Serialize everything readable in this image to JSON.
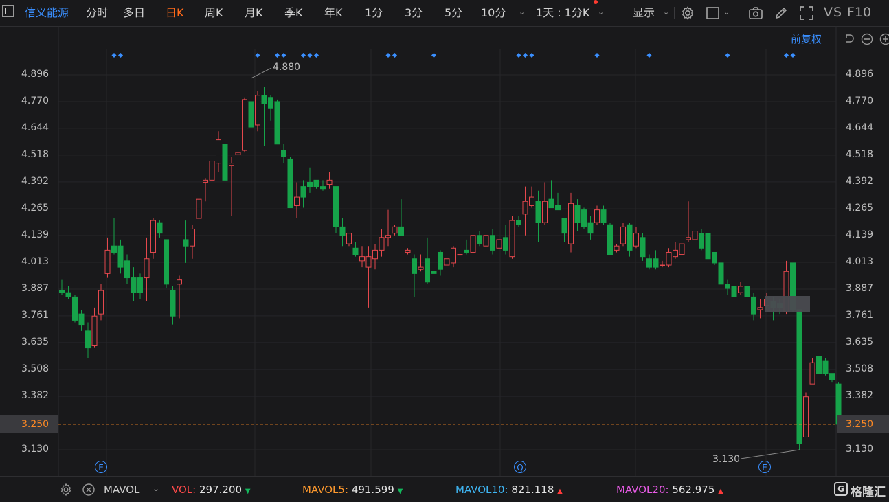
{
  "toolbar": {
    "stock_name": "信义能源",
    "periods": [
      "分时",
      "多日",
      "日K",
      "周K",
      "月K",
      "季K",
      "年K",
      "1分",
      "3分",
      "5分",
      "10分"
    ],
    "active_period": "日K",
    "range_selector": "1天 : 1分K",
    "display_menu": "显示",
    "vs": "VS",
    "f10": "F10"
  },
  "chart_controls": {
    "adjust_mode": "前复权"
  },
  "price_axis": {
    "ticks": [
      "4.896",
      "4.770",
      "4.644",
      "4.518",
      "4.392",
      "4.265",
      "4.139",
      "4.013",
      "3.887",
      "3.761",
      "3.635",
      "3.508",
      "3.382",
      "3.250",
      "3.130"
    ],
    "current_price": "3.250"
  },
  "annotations": {
    "high_label": "4.880",
    "low_label": "3.130",
    "events": [
      "E",
      "Q",
      "E"
    ]
  },
  "indicator_bar": {
    "indicator_name": "MAVOL",
    "vol_label": "VOL:",
    "vol_value": "297.200",
    "ma5_label": "MAVOL5:",
    "ma5_value": "491.599",
    "ma10_label": "MAVOL10:",
    "ma10_value": "821.118",
    "ma20_label": "MAVOL20:",
    "ma20_value": "562.975",
    "brand": "格隆汇"
  },
  "colors": {
    "up": "#e5484d",
    "down": "#16a34a",
    "accent": "#3a8fff",
    "active_tab": "#ff6a1a",
    "current_price_line": "#ff8a24"
  },
  "chart_data": {
    "type": "candlestick",
    "ylim": [
      3.1,
      4.95
    ],
    "candles": [
      {
        "o": 3.88,
        "h": 3.93,
        "l": 3.86,
        "c": 3.87
      },
      {
        "o": 3.87,
        "h": 3.9,
        "l": 3.84,
        "c": 3.85
      },
      {
        "o": 3.85,
        "h": 3.86,
        "l": 3.73,
        "c": 3.74
      },
      {
        "o": 3.77,
        "h": 3.79,
        "l": 3.69,
        "c": 3.72
      },
      {
        "o": 3.69,
        "h": 3.73,
        "l": 3.56,
        "c": 3.61
      },
      {
        "o": 3.62,
        "h": 3.8,
        "l": 3.61,
        "c": 3.76
      },
      {
        "o": 3.77,
        "h": 3.91,
        "l": 3.74,
        "c": 3.88
      },
      {
        "o": 3.96,
        "h": 4.13,
        "l": 3.94,
        "c": 4.07
      },
      {
        "o": 4.09,
        "h": 4.22,
        "l": 4.05,
        "c": 4.06
      },
      {
        "o": 4.09,
        "h": 4.12,
        "l": 3.96,
        "c": 3.99
      },
      {
        "o": 4.02,
        "h": 4.05,
        "l": 3.91,
        "c": 3.94
      },
      {
        "o": 3.94,
        "h": 3.99,
        "l": 3.83,
        "c": 3.87
      },
      {
        "o": 3.94,
        "h": 3.96,
        "l": 3.84,
        "c": 3.87
      },
      {
        "o": 3.94,
        "h": 4.13,
        "l": 3.83,
        "c": 4.03
      },
      {
        "o": 4.06,
        "h": 4.22,
        "l": 4.03,
        "c": 4.21
      },
      {
        "o": 4.2,
        "h": 4.21,
        "l": 4.13,
        "c": 4.15
      },
      {
        "o": 4.12,
        "h": 4.12,
        "l": 3.89,
        "c": 3.91
      },
      {
        "o": 3.88,
        "h": 3.9,
        "l": 3.72,
        "c": 3.76
      },
      {
        "o": 3.91,
        "h": 3.95,
        "l": 3.75,
        "c": 3.93
      },
      {
        "o": 4.12,
        "h": 4.21,
        "l": 4.01,
        "c": 4.09
      },
      {
        "o": 4.09,
        "h": 4.19,
        "l": 4.03,
        "c": 4.17
      },
      {
        "o": 4.22,
        "h": 4.33,
        "l": 4.18,
        "c": 4.31
      },
      {
        "o": 4.39,
        "h": 4.41,
        "l": 4.3,
        "c": 4.4
      },
      {
        "o": 4.4,
        "h": 4.56,
        "l": 4.32,
        "c": 4.49
      },
      {
        "o": 4.48,
        "h": 4.63,
        "l": 4.44,
        "c": 4.59
      },
      {
        "o": 4.57,
        "h": 4.67,
        "l": 4.39,
        "c": 4.4
      },
      {
        "o": 4.47,
        "h": 4.51,
        "l": 4.23,
        "c": 4.48
      },
      {
        "o": 4.52,
        "h": 4.69,
        "l": 4.4,
        "c": 4.53
      },
      {
        "o": 4.54,
        "h": 4.79,
        "l": 4.53,
        "c": 4.78
      },
      {
        "o": 4.77,
        "h": 4.88,
        "l": 4.62,
        "c": 4.65
      },
      {
        "o": 4.66,
        "h": 4.82,
        "l": 4.63,
        "c": 4.8
      },
      {
        "o": 4.8,
        "h": 4.84,
        "l": 4.56,
        "c": 4.76
      },
      {
        "o": 4.79,
        "h": 4.8,
        "l": 4.68,
        "c": 4.74
      },
      {
        "o": 4.77,
        "h": 4.78,
        "l": 4.57,
        "c": 4.57
      },
      {
        "o": 4.54,
        "h": 4.57,
        "l": 4.48,
        "c": 4.51
      },
      {
        "o": 4.5,
        "h": 4.51,
        "l": 4.27,
        "c": 4.27
      },
      {
        "o": 4.28,
        "h": 4.39,
        "l": 4.22,
        "c": 4.32
      },
      {
        "o": 4.37,
        "h": 4.4,
        "l": 4.27,
        "c": 4.32
      },
      {
        "o": 4.39,
        "h": 4.46,
        "l": 4.34,
        "c": 4.37
      },
      {
        "o": 4.4,
        "h": 4.4,
        "l": 4.36,
        "c": 4.37
      },
      {
        "o": 4.37,
        "h": 4.4,
        "l": 4.35,
        "c": 4.36
      },
      {
        "o": 4.38,
        "h": 4.44,
        "l": 4.36,
        "c": 4.4
      },
      {
        "o": 4.37,
        "h": 4.37,
        "l": 4.15,
        "c": 4.18
      },
      {
        "o": 4.18,
        "h": 4.22,
        "l": 4.09,
        "c": 4.14
      },
      {
        "o": 4.1,
        "h": 4.15,
        "l": 4.09,
        "c": 4.15
      },
      {
        "o": 4.08,
        "h": 4.11,
        "l": 4.04,
        "c": 4.05
      },
      {
        "o": 4.02,
        "h": 4.09,
        "l": 3.99,
        "c": 4.04
      },
      {
        "o": 3.99,
        "h": 4.09,
        "l": 3.8,
        "c": 4.04
      },
      {
        "o": 4.03,
        "h": 4.1,
        "l": 3.98,
        "c": 4.07
      },
      {
        "o": 4.07,
        "h": 4.17,
        "l": 4.04,
        "c": 4.13
      },
      {
        "o": 4.13,
        "h": 4.26,
        "l": 4.09,
        "c": 4.14
      },
      {
        "o": 4.15,
        "h": 4.19,
        "l": 4.14,
        "c": 4.18
      },
      {
        "o": 4.18,
        "h": 4.31,
        "l": 4.15,
        "c": 4.14
      },
      {
        "o": 4.06,
        "h": 4.08,
        "l": 4.05,
        "c": 4.07
      },
      {
        "o": 4.03,
        "h": 4.05,
        "l": 3.85,
        "c": 3.96
      },
      {
        "o": 3.98,
        "h": 4.05,
        "l": 3.97,
        "c": 3.99
      },
      {
        "o": 4.03,
        "h": 4.13,
        "l": 3.91,
        "c": 3.92
      },
      {
        "o": 3.97,
        "h": 3.99,
        "l": 3.93,
        "c": 3.96
      },
      {
        "o": 4.06,
        "h": 4.07,
        "l": 3.95,
        "c": 3.98
      },
      {
        "o": 4.0,
        "h": 4.04,
        "l": 3.99,
        "c": 4.03
      },
      {
        "o": 4.01,
        "h": 4.09,
        "l": 3.99,
        "c": 4.08
      },
      {
        "o": 4.05,
        "h": 4.06,
        "l": 4.05,
        "c": 4.05
      },
      {
        "o": 4.07,
        "h": 4.12,
        "l": 4.05,
        "c": 4.06
      },
      {
        "o": 4.06,
        "h": 4.16,
        "l": 4.05,
        "c": 4.14
      },
      {
        "o": 4.14,
        "h": 4.16,
        "l": 4.09,
        "c": 4.1
      },
      {
        "o": 4.09,
        "h": 4.16,
        "l": 4.09,
        "c": 4.14
      },
      {
        "o": 4.14,
        "h": 4.17,
        "l": 4.05,
        "c": 4.07
      },
      {
        "o": 4.08,
        "h": 4.15,
        "l": 4.03,
        "c": 4.12
      },
      {
        "o": 4.13,
        "h": 4.19,
        "l": 4.05,
        "c": 4.07
      },
      {
        "o": 4.04,
        "h": 4.23,
        "l": 4.03,
        "c": 4.21
      },
      {
        "o": 4.21,
        "h": 4.23,
        "l": 4.18,
        "c": 4.19
      },
      {
        "o": 4.24,
        "h": 4.37,
        "l": 4.14,
        "c": 4.3
      },
      {
        "o": 4.28,
        "h": 4.37,
        "l": 4.27,
        "c": 4.32
      },
      {
        "o": 4.3,
        "h": 4.35,
        "l": 4.11,
        "c": 4.2
      },
      {
        "o": 4.2,
        "h": 4.39,
        "l": 4.19,
        "c": 4.3
      },
      {
        "o": 4.31,
        "h": 4.4,
        "l": 4.28,
        "c": 4.27
      },
      {
        "o": 4.28,
        "h": 4.34,
        "l": 4.26,
        "c": 4.26
      },
      {
        "o": 4.22,
        "h": 4.22,
        "l": 4.11,
        "c": 4.15
      },
      {
        "o": 4.1,
        "h": 4.34,
        "l": 4.06,
        "c": 4.29
      },
      {
        "o": 4.28,
        "h": 4.31,
        "l": 4.16,
        "c": 4.2
      },
      {
        "o": 4.26,
        "h": 4.27,
        "l": 4.17,
        "c": 4.18
      },
      {
        "o": 4.2,
        "h": 4.23,
        "l": 4.12,
        "c": 4.15
      },
      {
        "o": 4.2,
        "h": 4.28,
        "l": 4.19,
        "c": 4.26
      },
      {
        "o": 4.26,
        "h": 4.28,
        "l": 4.19,
        "c": 4.2
      },
      {
        "o": 4.19,
        "h": 4.2,
        "l": 4.05,
        "c": 4.05
      },
      {
        "o": 4.07,
        "h": 4.1,
        "l": 4.06,
        "c": 4.09
      },
      {
        "o": 4.1,
        "h": 4.2,
        "l": 4.09,
        "c": 4.18
      },
      {
        "o": 4.19,
        "h": 4.2,
        "l": 4.04,
        "c": 4.07
      },
      {
        "o": 4.09,
        "h": 4.18,
        "l": 4.08,
        "c": 4.15
      },
      {
        "o": 4.13,
        "h": 4.15,
        "l": 4.02,
        "c": 4.04
      },
      {
        "o": 4.03,
        "h": 4.05,
        "l": 3.98,
        "c": 3.99
      },
      {
        "o": 4.03,
        "h": 4.07,
        "l": 3.98,
        "c": 3.99
      },
      {
        "o": 4.0,
        "h": 4.02,
        "l": 3.99,
        "c": 4.0
      },
      {
        "o": 4.0,
        "h": 4.08,
        "l": 3.99,
        "c": 4.06
      },
      {
        "o": 4.04,
        "h": 4.11,
        "l": 4.03,
        "c": 4.07
      },
      {
        "o": 4.05,
        "h": 4.12,
        "l": 3.99,
        "c": 4.1
      },
      {
        "o": 4.12,
        "h": 4.3,
        "l": 4.11,
        "c": 4.13
      },
      {
        "o": 4.12,
        "h": 4.21,
        "l": 4.09,
        "c": 4.16
      },
      {
        "o": 4.15,
        "h": 4.17,
        "l": 4.07,
        "c": 4.08
      },
      {
        "o": 4.15,
        "h": 4.15,
        "l": 4.01,
        "c": 4.03
      },
      {
        "o": 4.06,
        "h": 4.06,
        "l": 4.0,
        "c": 4.01
      },
      {
        "o": 4.01,
        "h": 4.05,
        "l": 3.88,
        "c": 3.91
      },
      {
        "o": 3.91,
        "h": 3.93,
        "l": 3.86,
        "c": 3.89
      },
      {
        "o": 3.9,
        "h": 3.92,
        "l": 3.84,
        "c": 3.85
      },
      {
        "o": 3.87,
        "h": 3.92,
        "l": 3.86,
        "c": 3.9
      },
      {
        "o": 3.9,
        "h": 3.91,
        "l": 3.84,
        "c": 3.85
      },
      {
        "o": 3.85,
        "h": 3.87,
        "l": 3.74,
        "c": 3.77
      },
      {
        "o": 3.79,
        "h": 3.84,
        "l": 3.75,
        "c": 3.8
      },
      {
        "o": 3.81,
        "h": 3.87,
        "l": 3.79,
        "c": 3.84
      },
      {
        "o": 3.83,
        "h": 3.85,
        "l": 3.74,
        "c": 3.8
      },
      {
        "o": 3.82,
        "h": 3.84,
        "l": 3.77,
        "c": 3.8
      },
      {
        "o": 3.78,
        "h": 4.02,
        "l": 3.77,
        "c": 3.97
      },
      {
        "o": 4.01,
        "h": 4.01,
        "l": 3.78,
        "c": 3.79
      },
      {
        "o": 3.79,
        "h": 3.79,
        "l": 3.13,
        "c": 3.16
      },
      {
        "o": 3.19,
        "h": 3.4,
        "l": 3.19,
        "c": 3.38
      },
      {
        "o": 3.44,
        "h": 3.56,
        "l": 3.44,
        "c": 3.54
      },
      {
        "o": 3.57,
        "h": 3.57,
        "l": 3.49,
        "c": 3.49
      },
      {
        "o": 3.55,
        "h": 3.56,
        "l": 3.48,
        "c": 3.49
      },
      {
        "o": 3.49,
        "h": 3.49,
        "l": 3.45,
        "c": 3.46
      },
      {
        "o": 3.44,
        "h": 3.45,
        "l": 3.25,
        "c": 3.25
      }
    ],
    "event_marker_positions": [
      8,
      9,
      30,
      33,
      34,
      37,
      38,
      39,
      50,
      51,
      57,
      70,
      71,
      72,
      82,
      90,
      102,
      111,
      112
    ]
  }
}
